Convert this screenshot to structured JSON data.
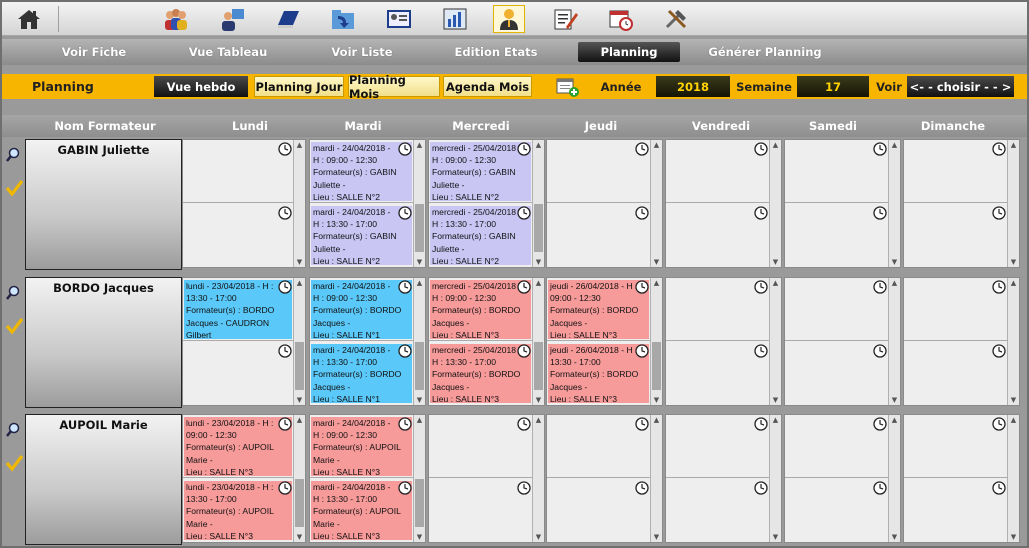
{
  "toolbar": {
    "icons": [
      "home-icon",
      "users-group-icon",
      "trainer-icon",
      "book-icon",
      "folder-arrow-icon",
      "id-card-icon",
      "chart-icon",
      "person-highlight-icon",
      "edit-document-icon",
      "calendar-clock-icon",
      "tools-icon"
    ]
  },
  "nav": {
    "tabs": [
      "Voir Fiche",
      "Vue Tableau",
      "Voir Liste",
      "Edition Etats",
      "Planning",
      "Générer Planning"
    ],
    "active": "Planning"
  },
  "controls": {
    "title": "Planning",
    "vue_hebdo": "Vue hebdo",
    "planning_jour": "Planning Jour",
    "planning_mois": "Planning  Mois",
    "agenda_mois": "Agenda  Mois",
    "annee_label": "Année",
    "annee_value": "2018",
    "semaine_label": "Semaine",
    "semaine_value": "17",
    "voir_label": "Voir",
    "choisir": "<- - choisir - - >"
  },
  "columns": [
    "Nom Formateur",
    "Lundi",
    "Mardi",
    "Mercredi",
    "Jeudi",
    "Vendredi",
    "Samedi",
    "Dimanche"
  ],
  "rows": [
    {
      "name": "GABIN Juliette",
      "events": {
        "mardi_am": [
          "mardi    -    24/04/2018 -",
          "H : 09:00 - 12:30",
          "Formateur(s)  :  GABIN",
          "Juliette -",
          "Lieu : SALLE N°2"
        ],
        "mardi_pm": [
          "mardi    -    24/04/2018 -",
          "H : 13:30 - 17:00",
          "Formateur(s)  :  GABIN",
          "Juliette -",
          "Lieu : SALLE N°2"
        ],
        "mercredi_am": [
          "mercredi - 25/04/2018 -",
          "H : 09:00 - 12:30",
          "Formateur(s)  :  GABIN",
          "Juliette -",
          "Lieu : SALLE N°2"
        ],
        "mercredi_pm": [
          "mercredi - 25/04/2018 -",
          "H : 13:30 - 17:00",
          "Formateur(s)  :  GABIN",
          "Juliette -",
          "Lieu : SALLE N°2"
        ]
      }
    },
    {
      "name": "BORDO Jacques",
      "events": {
        "lundi_am": [
          "lundi - 23/04/2018 - H :",
          "13:30 - 17:00",
          "Formateur(s)  :  BORDO",
          "Jacques   -   CAUDRON",
          "Gilbert"
        ],
        "mardi_am": [
          "mardi    -    24/04/2018 -",
          "H : 09:00 - 12:30",
          "Formateur(s)  :  BORDO",
          "Jacques -",
          "Lieu : SALLE N°1"
        ],
        "mardi_pm": [
          "mardi    -    24/04/2018 -",
          "H : 13:30 - 17:00",
          "Formateur(s)  :  BORDO",
          "Jacques -",
          "Lieu : SALLE N°1"
        ],
        "mercredi_am": [
          "mercredi - 25/04/2018 -",
          "H : 09:00 - 12:30",
          "Formateur(s)  :  BORDO",
          "Jacques -",
          "Lieu : SALLE N°3"
        ],
        "mercredi_pm": [
          "mercredi - 25/04/2018 -",
          "H : 13:30 - 17:00",
          "Formateur(s)  :  BORDO",
          "Jacques -",
          "Lieu : SALLE N°3"
        ],
        "jeudi_am": [
          "jeudi - 26/04/2018 - H :",
          "09:00 - 12:30",
          "Formateur(s)  :  BORDO",
          "Jacques -",
          "Lieu : SALLE N°3"
        ],
        "jeudi_pm": [
          "jeudi - 26/04/2018 - H :",
          "13:30 - 17:00",
          "Formateur(s)  :  BORDO",
          "Jacques -",
          "Lieu : SALLE N°3"
        ]
      }
    },
    {
      "name": "AUPOIL Marie",
      "events": {
        "lundi_am": [
          "lundi - 23/04/2018 - H :",
          "09:00 - 12:30",
          "Formateur(s)  :  AUPOIL",
          "Marie -",
          "Lieu : SALLE N°3"
        ],
        "lundi_pm": [
          "lundi - 23/04/2018 - H :",
          "13:30 - 17:00",
          "Formateur(s)  :  AUPOIL",
          "Marie -",
          "Lieu : SALLE N°3"
        ],
        "mardi_am": [
          "mardi    -    24/04/2018 -",
          "H : 09:00 - 12:30",
          "Formateur(s)  :  AUPOIL",
          "Marie -",
          "Lieu : SALLE N°3"
        ],
        "mardi_pm": [
          "mardi    -    24/04/2018 -",
          "H : 13:30 - 17:00",
          "Formateur(s)  :  AUPOIL",
          "Marie -",
          "Lieu : SALLE N°3"
        ]
      }
    }
  ],
  "colors": {
    "accent": "#f7b500",
    "event_purple": "#c9c6f4",
    "event_blue": "#5ac8f8",
    "event_red": "#f79a9a"
  }
}
